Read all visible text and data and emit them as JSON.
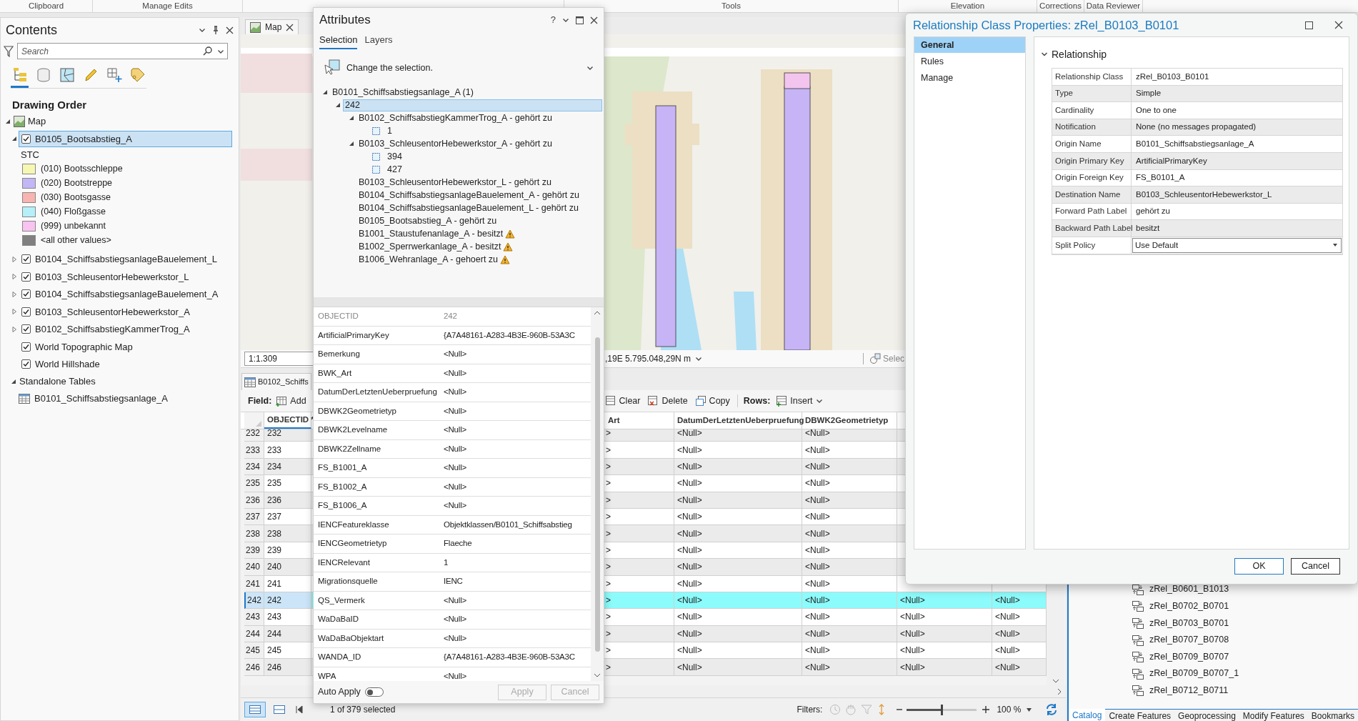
{
  "ribbon": {
    "groups": [
      "Clipboard",
      "Manage Edits",
      "Tools",
      "Elevation",
      "Corrections",
      "Data Reviewer"
    ]
  },
  "contents": {
    "title": "Contents",
    "search": {
      "placeholder": "Search"
    },
    "view_tabs": [
      {
        "kind": "drawing-order",
        "selected": true
      },
      {
        "kind": "data-source",
        "selected": false
      },
      {
        "kind": "selection",
        "selected": false
      },
      {
        "kind": "editing",
        "selected": false
      },
      {
        "kind": "snapping",
        "selected": false
      },
      {
        "kind": "labeling",
        "selected": false
      }
    ],
    "heading": "Drawing Order",
    "map": {
      "label": "Map",
      "expanded": true
    },
    "layers": [
      {
        "label": "B0105_Bootsabstieg_A",
        "checked": true,
        "expanded": true,
        "selected": true,
        "legend": {
          "field": "STC",
          "classes": [
            {
              "label": "(010) Bootsschleppe",
              "color": "#f5f7b3"
            },
            {
              "label": "(020) Bootstreppe",
              "color": "#c3b6f6"
            },
            {
              "label": "(030) Bootsgasse",
              "color": "#f8b4b0"
            },
            {
              "label": "(040) Floßgasse",
              "color": "#b5f0f8"
            },
            {
              "label": "(999) unbekannt",
              "color": "#f8c3ef"
            },
            {
              "label": "<all other values>",
              "color": "#808080"
            }
          ]
        }
      },
      {
        "label": "B0104_SchiffsabstiegsanlageBauelement_L",
        "checked": true,
        "expanded": false,
        "selected": false
      },
      {
        "label": "B0103_SchleusentorHebewerkstor_L",
        "checked": true,
        "expanded": false,
        "selected": false
      },
      {
        "label": "B0104_SchiffsabstiegsanlageBauelement_A",
        "checked": true,
        "expanded": false,
        "selected": false
      },
      {
        "label": "B0103_SchleusentorHebewerkstor_A",
        "checked": true,
        "expanded": false,
        "selected": false
      },
      {
        "label": "B0102_SchiffsabstiegKammerTrog_A",
        "checked": true,
        "expanded": false,
        "selected": false
      },
      {
        "label": "World Topographic Map",
        "checked": true,
        "selected": false
      },
      {
        "label": "World Hillshade",
        "checked": true,
        "selected": false
      }
    ],
    "standalone": {
      "label": "Standalone Tables",
      "expanded": true,
      "tables": [
        {
          "label": "B0101_Schiffsabstiegsanlage_A"
        }
      ]
    }
  },
  "map_view": {
    "tab": {
      "label": "Map",
      "selected": true
    },
    "scale": "1:1.309",
    "coordinates": ",19E 5.795.048,29N m",
    "select_label": "Selec"
  },
  "table": {
    "tab": "B0102_Schiffs",
    "toolbar": {
      "field_label": "Field:",
      "add": "Add",
      "buttons": [
        "Clear",
        "Delete",
        "Copy"
      ],
      "rows_label": "Rows:",
      "insert": "Insert"
    },
    "columns": [
      "OBJECTID *",
      "Art",
      "DatumDerLetztenUeberpruefung",
      "DBWK2Geometrietyp"
    ],
    "rows": [
      {
        "number": "232",
        "cells": [
          "232",
          ">",
          "<Null>",
          "<Null>"
        ],
        "selected": false
      },
      {
        "number": "233",
        "cells": [
          "233",
          ">",
          "<Null>",
          "<Null>"
        ],
        "selected": false
      },
      {
        "number": "234",
        "cells": [
          "234",
          ">",
          "<Null>",
          "<Null>"
        ],
        "selected": false
      },
      {
        "number": "235",
        "cells": [
          "235",
          ">",
          "<Null>",
          "<Null>"
        ],
        "selected": false
      },
      {
        "number": "236",
        "cells": [
          "236",
          ">",
          "<Null>",
          "<Null>"
        ],
        "selected": false
      },
      {
        "number": "237",
        "cells": [
          "237",
          ">",
          "<Null>",
          "<Null>"
        ],
        "selected": false
      },
      {
        "number": "238",
        "cells": [
          "238",
          ">",
          "<Null>",
          "<Null>"
        ],
        "selected": false
      },
      {
        "number": "239",
        "cells": [
          "239",
          ">",
          "<Null>",
          "<Null>"
        ],
        "selected": false
      },
      {
        "number": "240",
        "cells": [
          "240",
          ">",
          "<Null>",
          "<Null>"
        ],
        "selected": false
      },
      {
        "number": "241",
        "cells": [
          "241",
          ">",
          "<Null>",
          "<Null>"
        ],
        "selected": false
      },
      {
        "number": "242",
        "cells": [
          "242",
          ">",
          "<Null>",
          "<Null>",
          "<Null>",
          "<Null>"
        ],
        "selected": true
      },
      {
        "number": "243",
        "cells": [
          "243",
          ">",
          "<Null>",
          "<Null>",
          "<Null>",
          "<Null>"
        ],
        "selected": false
      },
      {
        "number": "244",
        "cells": [
          "244",
          ">",
          "<Null>",
          "<Null>",
          "<Null>",
          "<Null>"
        ],
        "selected": false
      },
      {
        "number": "245",
        "cells": [
          "245",
          ">",
          "<Null>",
          "<Null>",
          "<Null>",
          "<Null>"
        ],
        "selected": false
      },
      {
        "number": "246",
        "cells": [
          "246",
          ">",
          "<Null>",
          "<Null>",
          "<Null>",
          "<Null>"
        ],
        "selected": false
      }
    ],
    "status": {
      "selection": "1 of 379 selected",
      "filters_label": "Filters:",
      "zoom": "100 %",
      "zoom_slider": {
        "level": 0.5
      }
    }
  },
  "attributes": {
    "title": "Attributes",
    "help": "?",
    "tabs": [
      {
        "label": "Selection",
        "selected": true
      },
      {
        "label": "Layers",
        "selected": false
      }
    ],
    "hint": "Change the selection.",
    "tree": {
      "label": "B0101_Schiffsabstiegsanlage_A (1)",
      "expanded": true,
      "selected": false,
      "children": [
        {
          "label": "242",
          "expanded": true,
          "selected": true,
          "children": [
            {
              "label": "B0102_SchiffsabstiegKammerTrog_A - gehört zu",
              "kind": "relationship",
              "expanded": true,
              "selected": false,
              "warning": false,
              "children": [
                {
                  "label": "1",
                  "kind": "feature",
                  "selected": false
                }
              ]
            },
            {
              "label": "B0103_SchleusentorHebewerkstor_A - gehört zu",
              "kind": "relationship",
              "expanded": true,
              "selected": false,
              "warning": false,
              "children": [
                {
                  "label": "394",
                  "kind": "feature",
                  "selected": false
                },
                {
                  "label": "427",
                  "kind": "feature",
                  "selected": false
                }
              ]
            },
            {
              "label": "B0103_SchleusentorHebewerkstor_L - gehört zu",
              "kind": "relationship",
              "selected": false,
              "warning": false
            },
            {
              "label": "B0104_SchiffsabstiegsanlageBauelement_A - gehört zu",
              "kind": "relationship",
              "selected": false,
              "warning": false
            },
            {
              "label": "B0104_SchiffsabstiegsanlageBauelement_L - gehört zu",
              "kind": "relationship",
              "selected": false,
              "warning": false
            },
            {
              "label": "B0105_Bootsabstieg_A - gehört zu",
              "kind": "relationship",
              "selected": false,
              "warning": false
            },
            {
              "label": "B1001_Staustufenanlage_A - besitzt",
              "kind": "relationship",
              "selected": false,
              "warning": true
            },
            {
              "label": "B1002_Sperrwerkanlage_A - besitzt",
              "kind": "relationship",
              "selected": false,
              "warning": true
            },
            {
              "label": "B1006_Wehranlage_A - gehoert zu",
              "kind": "relationship",
              "selected": false,
              "warning": true
            }
          ]
        }
      ]
    },
    "fields": [
      {
        "name": "OBJECTID",
        "value": "242",
        "editable": false
      },
      {
        "name": "ArtificialPrimaryKey",
        "value": "{A7A48161-A283-4B3E-960B-53A3C",
        "editable": true
      },
      {
        "name": "Bemerkung",
        "value": "<Null>",
        "editable": true
      },
      {
        "name": "BWK_Art",
        "value": "<Null>",
        "editable": true
      },
      {
        "name": "DatumDerLetztenUeberpruefung",
        "value": "<Null>",
        "editable": true
      },
      {
        "name": "DBWK2Geometrietyp",
        "value": "<Null>",
        "editable": true
      },
      {
        "name": "DBWK2Levelname",
        "value": "<Null>",
        "editable": true
      },
      {
        "name": "DBWK2Zellname",
        "value": "<Null>",
        "editable": true
      },
      {
        "name": "FS_B1001_A",
        "value": "<Null>",
        "editable": true
      },
      {
        "name": "FS_B1002_A",
        "value": "<Null>",
        "editable": true
      },
      {
        "name": "FS_B1006_A",
        "value": "<Null>",
        "editable": true
      },
      {
        "name": "IENCFeatureklasse",
        "value": "Objektklassen/B0101_Schiffsabstieg",
        "editable": true
      },
      {
        "name": "IENCGeometrietyp",
        "value": "Flaeche",
        "editable": true
      },
      {
        "name": "IENCRelevant",
        "value": "1",
        "editable": true
      },
      {
        "name": "Migrationsquelle",
        "value": "IENC",
        "editable": true
      },
      {
        "name": "QS_Vermerk",
        "value": "<Null>",
        "editable": true
      },
      {
        "name": "WaDaBaID",
        "value": "<Null>",
        "editable": true
      },
      {
        "name": "WaDaBaObjektart",
        "value": "<Null>",
        "editable": true
      },
      {
        "name": "WANDA_ID",
        "value": "{A7A48161-A283-4B3E-960B-53A3C",
        "editable": true
      },
      {
        "name": "WPA",
        "value": "<Null>",
        "editable": true
      }
    ],
    "auto_apply": {
      "label": "Auto Apply",
      "on": false
    },
    "buttons": [
      {
        "label": "Apply",
        "disabled": true
      },
      {
        "label": "Cancel",
        "disabled": true
      }
    ]
  },
  "dialog": {
    "title": "Relationship Class Properties: zRel_B0103_B0101",
    "nav": [
      {
        "label": "General",
        "selected": true
      },
      {
        "label": "Rules",
        "selected": false
      },
      {
        "label": "Manage",
        "selected": false
      }
    ],
    "section": {
      "title": "Relationship",
      "expanded": true
    },
    "properties": [
      {
        "label": "Relationship Class",
        "value": "zRel_B0103_B0101",
        "kind": "text"
      },
      {
        "label": "Type",
        "value": "Simple",
        "kind": "text"
      },
      {
        "label": "Cardinality",
        "value": "One to one",
        "kind": "text"
      },
      {
        "label": "Notification",
        "value": "None (no messages propagated)",
        "kind": "text"
      },
      {
        "label": "Origin Name",
        "value": "B0101_Schiffsabstiegsanlage_A",
        "kind": "text"
      },
      {
        "label": "Origin Primary Key",
        "value": "ArtificialPrimaryKey",
        "kind": "text"
      },
      {
        "label": "Origin Foreign Key",
        "value": "FS_B0101_A",
        "kind": "text"
      },
      {
        "label": "Destination Name",
        "value": "B0103_SchleusentorHebewerkstor_L",
        "kind": "text"
      },
      {
        "label": "Forward Path Label",
        "value": "gehört zu",
        "kind": "text"
      },
      {
        "label": "Backward Path Label",
        "value": "besitzt",
        "kind": "text"
      },
      {
        "label": "Split Policy",
        "value": "Use Default",
        "kind": "dropdown"
      }
    ],
    "buttons": [
      {
        "label": "OK",
        "kind": "primary"
      },
      {
        "label": "Cancel",
        "kind": "secondary"
      }
    ]
  },
  "catalog": {
    "items": [
      "zRel_B0601_B1013",
      "zRel_B0702_B0701",
      "zRel_B0703_B0701",
      "zRel_B0707_B0708",
      "zRel_B0709_B0707",
      "zRel_B0709_B0707_1",
      "zRel_B0712_B0711"
    ],
    "tabs": [
      {
        "label": "Catalog",
        "selected": true
      },
      {
        "label": "Create Features",
        "selected": false
      },
      {
        "label": "Geoprocessing",
        "selected": false
      },
      {
        "label": "Modify Features",
        "selected": false
      },
      {
        "label": "Bookmarks",
        "selected": false
      }
    ]
  }
}
